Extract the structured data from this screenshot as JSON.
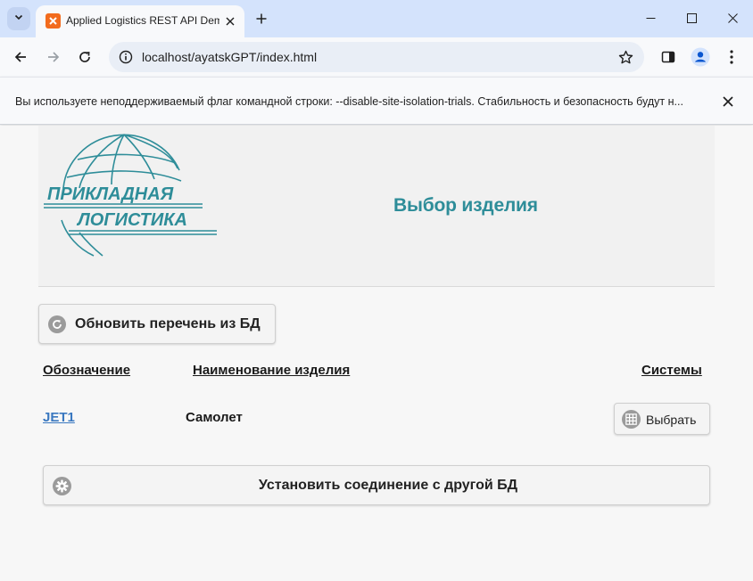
{
  "browser": {
    "tab_title": "Applied Logistics REST API Dem",
    "url": "localhost/ayatskGPT/index.html",
    "infobar_text": "Вы используете неподдерживаемый флаг командной строки: --disable-site-isolation-trials. Стабильность и безопасность будут н...",
    "colors": {
      "tabstrip": "#d4e3fc",
      "toolbar": "#f8f9fb",
      "favicon": "#f26b1d"
    }
  },
  "header": {
    "logo_line1": "ПРИКЛАДНАЯ",
    "logo_line2": "ЛОГИСТИКА",
    "title": "Выбор изделия",
    "accent_color": "#2e8d99"
  },
  "actions": {
    "refresh_label": "Обновить перечень из БД",
    "connect_label": "Установить соединение с другой БД"
  },
  "table": {
    "headers": {
      "code": "Обозначение",
      "name": "Наименование изделия",
      "systems": "Системы"
    },
    "rows": [
      {
        "code": "JET1",
        "name": "Самолет",
        "select_label": "Выбрать"
      }
    ]
  },
  "icons": {
    "refresh": "refresh-icon",
    "grid": "grid-icon",
    "settings": "gear-icon"
  }
}
